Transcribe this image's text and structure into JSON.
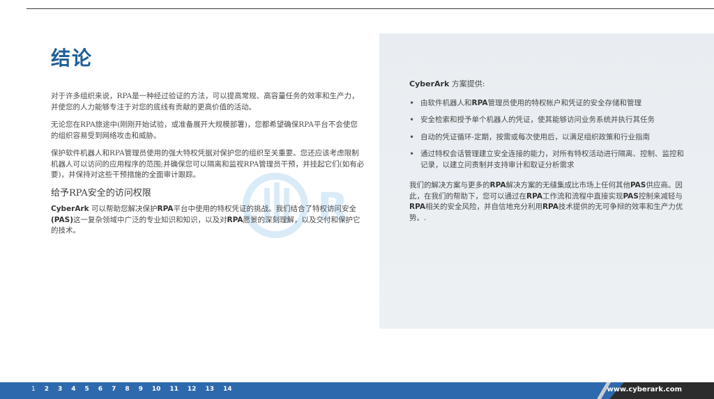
{
  "title": "结论",
  "left": {
    "p1": "对于许多组织来说，RPA是一种经过验证的方法，可以提高常规、高容量任务的效率和生产力，并使您的人力能够专注于对您的底线有贡献的更高价值的活动。",
    "p2": "无论您在RPA旅途中(刚刚开始试验，或准备展开大规模部署)，您都希望确保RPA平台不会使您的组织容易受到网络攻击和威胁。",
    "p3": "保护软件机器人和RPA管理员使用的强大特权凭据对保护您的组织至关重要。您还应该考虑限制机器人可以访问的应用程序的范围;并确保您可以隔离和监视RPA管理员干预，并挂起它们(如有必要)，并保持对这些干预措施的全面审计跟踪。",
    "subhead": "给予RPA安全的访问权限",
    "p4_brand": "CyberArk",
    "p4_a": " 可以帮助您解决保护",
    "p4_rpa": "RPA",
    "p4_b": "平台中使用的特权凭证的挑战。我们结合了特权访问安全",
    "p4_pas": "(PAS)",
    "p4_c": "这一复杂领域中广泛的专业知识和知识，以及对",
    "p4_rpa2": "RPA",
    "p4_d": "愿景的深刻理解，以及交付和保护它的技术。"
  },
  "right": {
    "head_brand": "CyberArk",
    "head_rest": " 方案提供:",
    "b1_a": "由软件机器人和",
    "b1_rpa": "RPA",
    "b1_b": "管理员使用的特权帐户和凭证的安全存储和管理",
    "b2": "安全检索和授予单个机器人的凭证，使其能够访问业务系统并执行其任务",
    "b3": "自动的凭证循环-定期，按需或每次使用后，以满足组织政策和行业指南",
    "b4": "通过特权会话管理建立安全连接的能力，对所有特权活动进行隔离、控制、监控和记录，以建立问责制并支持审计和取证分析需求",
    "para_a": "我们的解决方案与更多的",
    "para_rpa1": "RPA",
    "para_b": "解决方案的无缝集成比市场上任何其他",
    "para_pas1": "PAS",
    "para_c": "供应商。因此，在我们的帮助下，您可以通过在",
    "para_rpa2": "RPA",
    "para_d": "工作流和流程中直接实现",
    "para_pas2": "PAS",
    "para_e": "控制来减轻与",
    "para_rpa3": "RPA",
    "para_f": "相关的安全风险，并自信地充分利用",
    "para_rpa4": "RPA",
    "para_g": "技术提供的无可争辩的效率和生产力优势。."
  },
  "footer": {
    "pages": [
      "1",
      "2",
      "3",
      "4",
      "5",
      "6",
      "7",
      "8",
      "9",
      "10",
      "11",
      "12",
      "13",
      "14"
    ],
    "url": "www.cyberark.com"
  },
  "colors": {
    "title": "#1f5f98",
    "footer": "#2f69ad",
    "panel": "#eceff2"
  }
}
